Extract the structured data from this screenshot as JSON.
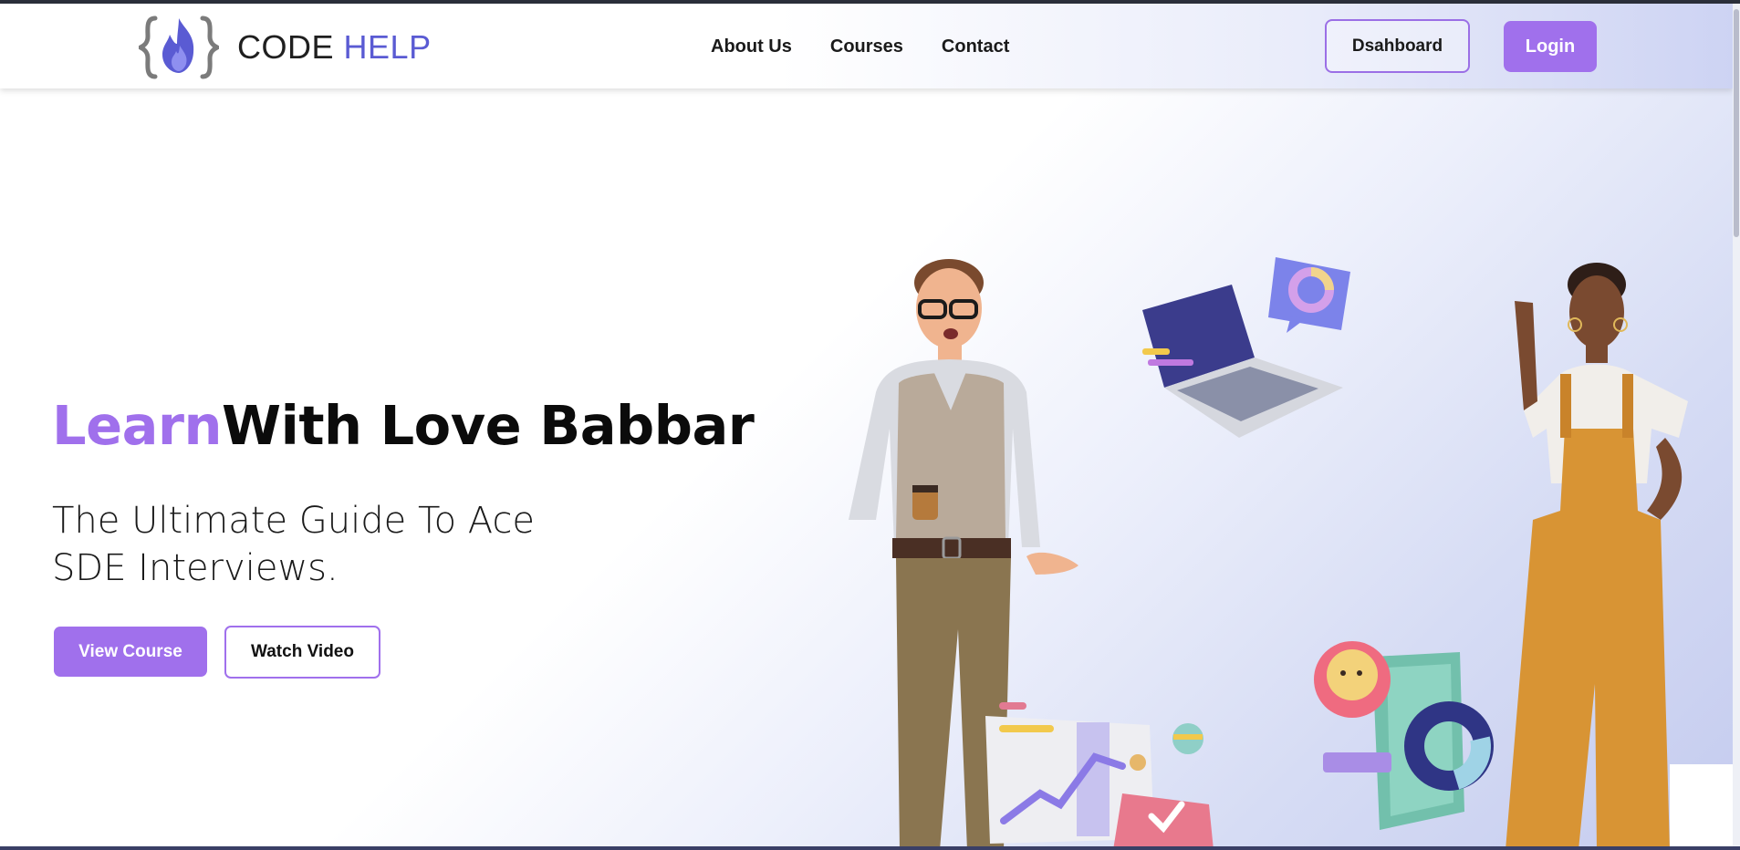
{
  "brand": {
    "code": "CODE",
    "help": "HELP",
    "colors": {
      "accent": "#a070ec",
      "help_blue": "#5a5bd3"
    }
  },
  "nav": {
    "items": [
      {
        "label": "About Us"
      },
      {
        "label": "Courses"
      },
      {
        "label": "Contact"
      }
    ]
  },
  "header_actions": {
    "dashboard_label": "Dsahboard",
    "login_label": "Login"
  },
  "hero": {
    "title_accent": "Learn",
    "title_rest": "With Love Babbar",
    "subtitle_line1": "The Ultimate Guide To Ace",
    "subtitle_line2": "SDE Interviews.",
    "view_course_label": "View Course",
    "watch_video_label": "Watch Video"
  },
  "icons": [
    "flame-braces-logo-icon"
  ]
}
